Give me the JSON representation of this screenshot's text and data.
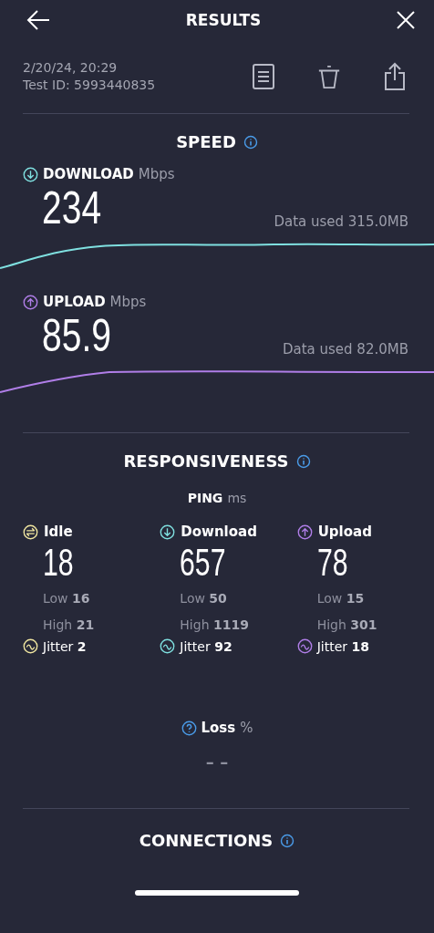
{
  "header": {
    "title": "RESULTS"
  },
  "meta": {
    "date": "2/20/24, 20:29",
    "test_id": "Test ID: 5993440835"
  },
  "speed": {
    "title": "SPEED",
    "items": [
      {
        "kind": "download",
        "label": "DOWNLOAD",
        "unit": "Mbps",
        "value": "234",
        "data_used": "Data used 315.0MB",
        "color": "#7fe0e0"
      },
      {
        "kind": "upload",
        "label": "UPLOAD",
        "unit": "Mbps",
        "value": "85.9",
        "data_used": "Data used 82.0MB",
        "color": "#b07ee8"
      }
    ]
  },
  "responsiveness": {
    "title": "RESPONSIVENESS",
    "ping_label": "PING",
    "ping_unit": "ms",
    "columns": [
      {
        "kind": "idle",
        "label": "Idle",
        "value": "18",
        "low_label": "Low",
        "low": "16",
        "high_label": "High",
        "high": "21",
        "jitter_label": "Jitter",
        "jitter": "2",
        "color": "#f0e6a0"
      },
      {
        "kind": "download",
        "label": "Download",
        "value": "657",
        "low_label": "Low",
        "low": "50",
        "high_label": "High",
        "high": "1119",
        "jitter_label": "Jitter",
        "jitter": "92",
        "color": "#7fe0e0"
      },
      {
        "kind": "upload",
        "label": "Upload",
        "value": "78",
        "low_label": "Low",
        "low": "15",
        "high_label": "High",
        "high": "301",
        "jitter_label": "Jitter",
        "jitter": "18",
        "color": "#b07ee8"
      }
    ],
    "loss_label": "Loss",
    "loss_unit": "%",
    "loss_value": "– –"
  },
  "connections": {
    "title": "CONNECTIONS"
  }
}
